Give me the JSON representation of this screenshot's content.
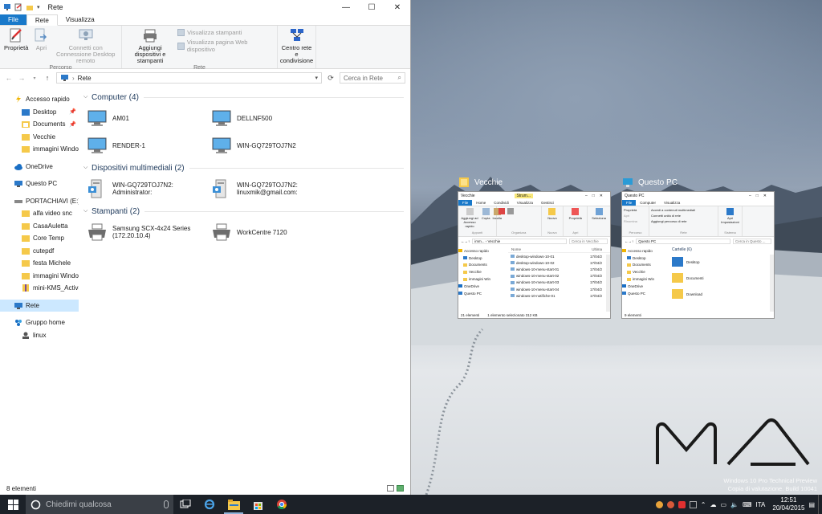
{
  "window": {
    "title": "Rete",
    "tabs": {
      "file": "File",
      "rete": "Rete",
      "visualizza": "Visualizza"
    }
  },
  "ribbon": {
    "proprieta": "Proprietà",
    "apri": "Apri",
    "connetti": "Connetti con Connessione Desktop remoto",
    "percorso_label": "Percorso",
    "aggiungi": "Aggiungi dispositivi e stampanti",
    "visualizza_stampanti": "Visualizza stampanti",
    "visualizza_pagina": "Visualizza pagina Web dispositivo",
    "rete_label": "Rete",
    "centro": "Centro rete e condivisione"
  },
  "address": {
    "path": "Rete",
    "search_placeholder": "Cerca in Rete"
  },
  "nav": {
    "accesso_rapido": "Accesso rapido",
    "desktop": "Desktop",
    "documents": "Documents",
    "vecchie": "Vecchie",
    "immagini": "immagini Window",
    "onedrive": "OneDrive",
    "questo_pc": "Questo PC",
    "portachiavi": "PORTACHIAVI (E:)",
    "alfa": "alfa video snc",
    "casa": "CasaAuletta",
    "core": "Core Temp",
    "cutepdf": "cutepdf",
    "festa": "festa Michele",
    "immagini2": "immagini Window",
    "minikms": "mini-KMS_Activat",
    "rete": "Rete",
    "gruppo": "Gruppo home",
    "linux": "linux"
  },
  "groups": {
    "computer": "Computer (4)",
    "multimedia": "Dispositivi multimediali (2)",
    "stampanti": "Stampanti (2)"
  },
  "computers": [
    "AM01",
    "DELLNF500",
    "RENDER-1",
    "WIN-GQ729TOJ7N2"
  ],
  "media": [
    "WIN-GQ729TOJ7N2: Administrator:",
    "WIN-GQ729TOJ7N2: linuxmik@gmail.com:"
  ],
  "printers": [
    "Samsung SCX-4x24 Series (172.20.10.4)",
    "WorkCentre 7120"
  ],
  "status": {
    "count": "8 elementi"
  },
  "taskview": {
    "vecchie": {
      "label": "Vecchie",
      "title": "Vecchie",
      "tool_tab": "Strum...",
      "tabs": [
        "File",
        "Home",
        "Condividi",
        "Visualizza",
        "Gestisci"
      ],
      "btns": [
        "Aggiungi ad Accesso rapido",
        "Copia",
        "Incolla",
        "Nuovo",
        "Proprietà",
        "Seleziona"
      ],
      "groups": [
        "Appunti",
        "Organizza",
        "Nuovo",
        "Apri"
      ],
      "path": "imm... › Vecchie",
      "search": "Cerca in Vecchie",
      "col_name": "Nome",
      "col_date": "Ultima",
      "nav": [
        "Accesso rapido",
        "Desktop",
        "Documents",
        "Vecchie",
        "immagini Win",
        "OneDrive",
        "Questo PC"
      ],
      "files": [
        "desktop-windows-10-01",
        "desktop-windows-10-02",
        "windows-10-menu-start-01",
        "windows-10-menu-start-02",
        "windows-10-menu-start-03",
        "windows-10-menu-start-04",
        "windows-10-notifiche-01"
      ],
      "date": "17/04/2",
      "status_a": "21 elementi",
      "status_b": "1 elemento selezionato  312 KB"
    },
    "questopc": {
      "label": "Questo PC",
      "title": "Questo PC",
      "tabs": [
        "File",
        "Computer",
        "Visualizza"
      ],
      "btns": [
        "Proprietà",
        "Apri",
        "Rinomina"
      ],
      "side": [
        "Accedi a contenuti multimediali",
        "Connetti unità di rete",
        "Aggiungi percorso di rete"
      ],
      "btn_agg": "Apri Impostazioni",
      "groups": [
        "Percorso",
        "Rete",
        "Sistema"
      ],
      "path": "Questo PC",
      "search": "Cerca in Questo ...",
      "folders_hdr": "Cartelle (6)",
      "folders": [
        "Desktop",
        "Documenti",
        "Download"
      ],
      "nav": [
        "Accesso rapido",
        "Desktop",
        "Documents",
        "Vecchie",
        "immagini Win",
        "OneDrive",
        "Questo PC"
      ],
      "status": "9 elementi"
    }
  },
  "watermark": {
    "line1": "Windows 10 Pro Technical Preview",
    "line2": "Copia di valutazione. Build 10041"
  },
  "taskbar": {
    "search": "Chiedimi qualcosa",
    "lang": "ITA",
    "time": "12:51",
    "date": "20/04/2015"
  },
  "colors": {
    "accent": "#1979ca",
    "taskbar": "#1c2128",
    "selection": "#cce8ff"
  }
}
